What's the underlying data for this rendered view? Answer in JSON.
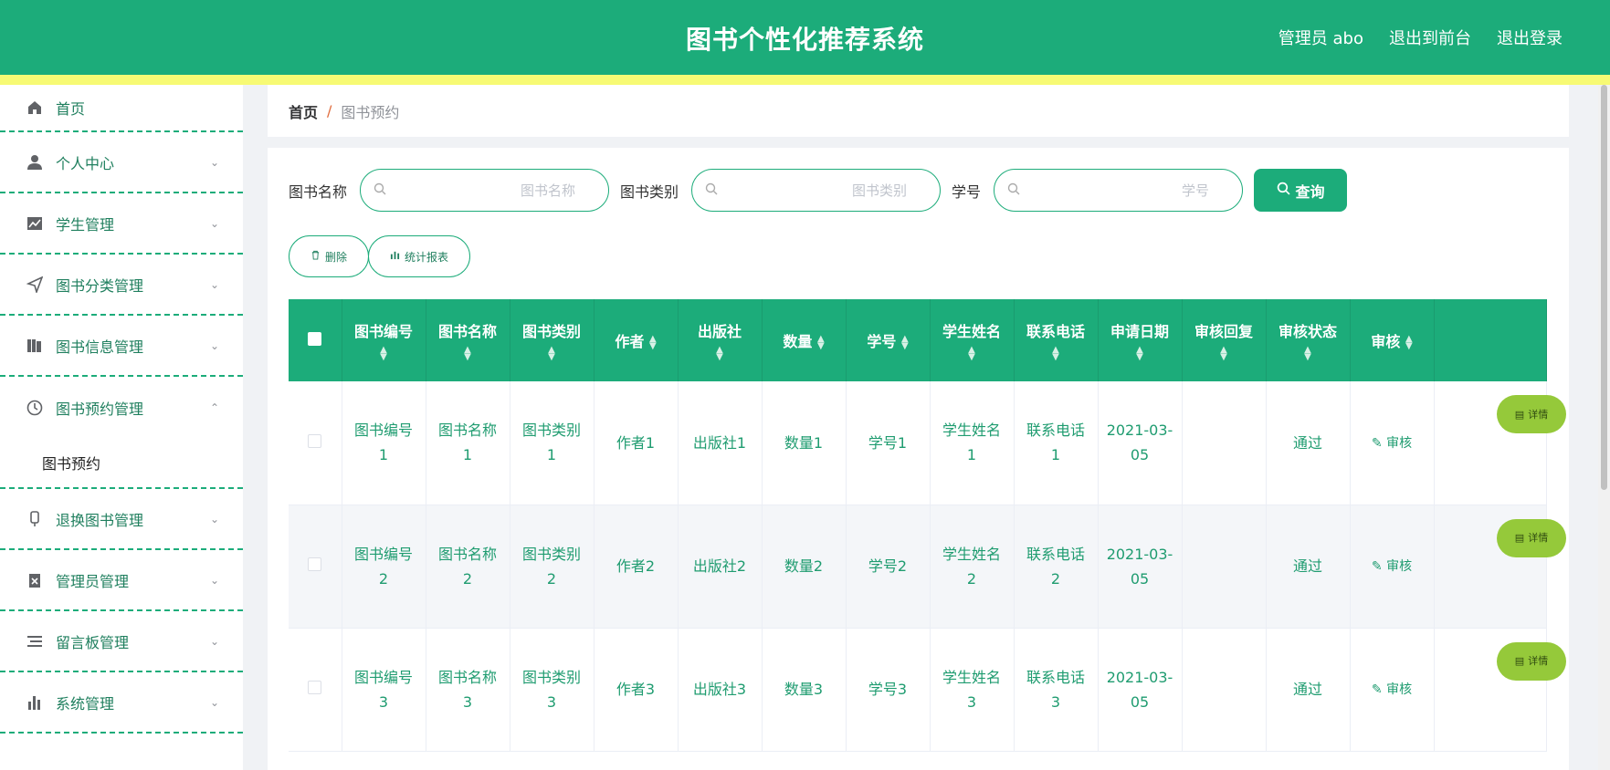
{
  "header": {
    "title": "图书个性化推荐系统",
    "links": [
      "管理员 abo",
      "退出到前台",
      "退出登录"
    ]
  },
  "sidebar": {
    "items": [
      {
        "label": "首页",
        "icon": "home-icon"
      },
      {
        "label": "个人中心",
        "icon": "user-icon"
      },
      {
        "label": "学生管理",
        "icon": "chart-icon"
      },
      {
        "label": "图书分类管理",
        "icon": "send-icon"
      },
      {
        "label": "图书信息管理",
        "icon": "books-icon"
      },
      {
        "label": "图书预约管理",
        "icon": "clock-icon"
      },
      {
        "label": "退换图书管理",
        "icon": "mic-icon"
      },
      {
        "label": "管理员管理",
        "icon": "clipboard-icon"
      },
      {
        "label": "留言板管理",
        "icon": "list-icon"
      },
      {
        "label": "系统管理",
        "icon": "bar-icon"
      }
    ],
    "sub_item": "图书预约"
  },
  "breadcrumb": {
    "home": "首页",
    "sep": "/",
    "current": "图书预约"
  },
  "search": {
    "book_name_label": "图书名称",
    "book_name_placeholder": "图书名称",
    "book_type_label": "图书类别",
    "book_type_placeholder": "图书类别",
    "student_no_label": "学号",
    "student_no_placeholder": "学号",
    "query_label": "查询"
  },
  "actions": {
    "delete_label": "删除",
    "report_label": "统计报表"
  },
  "table": {
    "headers": [
      "图书编号",
      "图书名称",
      "图书类别",
      "作者",
      "出版社",
      "数量",
      "学号",
      "学生姓名",
      "联系电话",
      "申请日期",
      "审核回复",
      "审核状态",
      "审核"
    ],
    "rows": [
      {
        "c": [
          "图书编号\n1",
          "图书名称\n1",
          "图书类别\n1",
          "作者1",
          "出版社1",
          "数量1",
          "学号1",
          "学生姓名\n1",
          "联系电话\n1",
          "2021-03-\n05",
          "",
          "通过"
        ]
      },
      {
        "c": [
          "图书编号\n2",
          "图书名称\n2",
          "图书类别\n2",
          "作者2",
          "出版社2",
          "数量2",
          "学号2",
          "学生姓名\n2",
          "联系电话\n2",
          "2021-03-\n05",
          "",
          "通过"
        ]
      },
      {
        "c": [
          "图书编号\n3",
          "图书名称\n3",
          "图书类别\n3",
          "作者3",
          "出版社3",
          "数量3",
          "学号3",
          "学生姓名\n3",
          "联系电话\n3",
          "2021-03-\n05",
          "",
          "通过"
        ]
      }
    ],
    "audit_label": "审核",
    "detail_label": "详情"
  }
}
